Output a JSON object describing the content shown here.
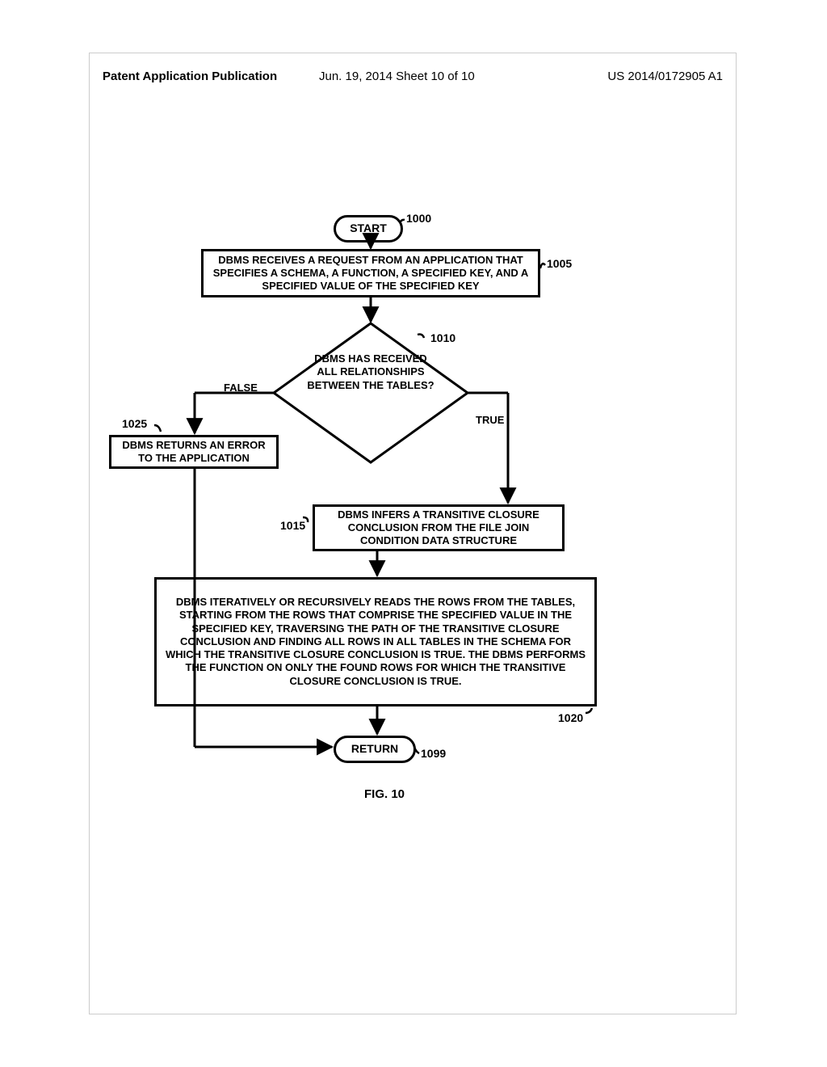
{
  "header": {
    "left": "Patent Application Publication",
    "mid": "Jun. 19, 2014  Sheet 10 of 10",
    "right": "US 2014/0172905 A1"
  },
  "figure_label": "FIG. 10",
  "chart_data": {
    "type": "flowchart",
    "nodes": [
      {
        "id": "1000",
        "kind": "terminator",
        "label": "START",
        "ref": "1000"
      },
      {
        "id": "1005",
        "kind": "process",
        "label": "DBMS RECEIVES A REQUEST FROM AN APPLICATION THAT SPECIFIES A SCHEMA, A FUNCTION, A SPECIFIED KEY, AND A SPECIFIED VALUE OF THE SPECIFIED KEY",
        "ref": "1005"
      },
      {
        "id": "1010",
        "kind": "decision",
        "label": "DBMS HAS RECEIVED ALL RELATIONSHIPS BETWEEN THE TABLES?",
        "ref": "1010"
      },
      {
        "id": "1025",
        "kind": "process",
        "label": "DBMS RETURNS AN ERROR TO THE APPLICATION",
        "ref": "1025"
      },
      {
        "id": "1015",
        "kind": "process",
        "label": "DBMS INFERS A TRANSITIVE CLOSURE CONCLUSION FROM THE FILE JOIN CONDITION DATA STRUCTURE",
        "ref": "1015"
      },
      {
        "id": "1020",
        "kind": "process",
        "label": "DBMS ITERATIVELY OR RECURSIVELY READS THE ROWS FROM THE TABLES, STARTING FROM THE ROWS THAT COMPRISE THE SPECIFIED VALUE IN THE SPECIFIED KEY, TRAVERSING THE PATH OF THE TRANSITIVE CLOSURE CONCLUSION AND FINDING ALL ROWS IN ALL TABLES IN THE SCHEMA FOR WHICH THE TRANSITIVE CLOSURE CONCLUSION IS TRUE. THE DBMS PERFORMS THE FUNCTION ON ONLY THE FOUND ROWS FOR WHICH THE TRANSITIVE CLOSURE CONCLUSION IS TRUE.",
        "ref": "1020"
      },
      {
        "id": "1099",
        "kind": "terminator",
        "label": "RETURN",
        "ref": "1099"
      }
    ],
    "edges": [
      {
        "from": "1000",
        "to": "1005"
      },
      {
        "from": "1005",
        "to": "1010"
      },
      {
        "from": "1010",
        "to": "1025",
        "label": "FALSE"
      },
      {
        "from": "1010",
        "to": "1015",
        "label": "TRUE"
      },
      {
        "from": "1015",
        "to": "1020"
      },
      {
        "from": "1020",
        "to": "1099"
      },
      {
        "from": "1025",
        "to": "1099"
      }
    ]
  }
}
